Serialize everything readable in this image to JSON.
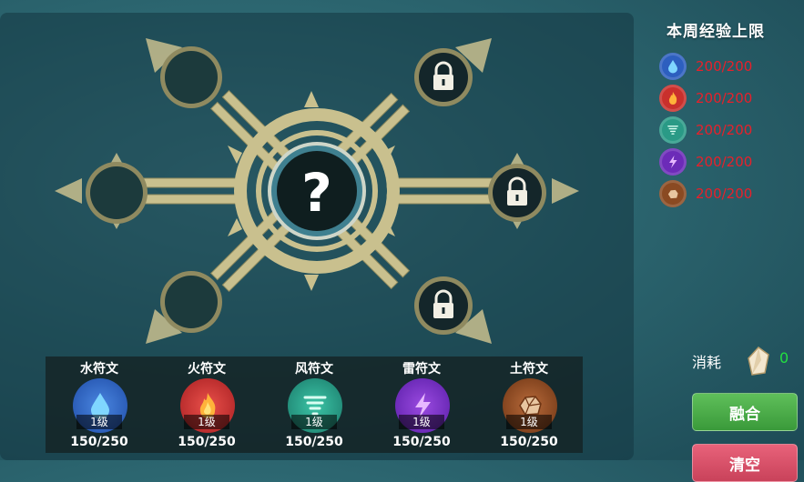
{
  "sidebar": {
    "title": "本周经验上限",
    "exp": [
      {
        "element": "water",
        "icon": "water-drop-icon",
        "value": "200/200",
        "color": "#2d5fbf"
      },
      {
        "element": "fire",
        "icon": "flame-icon",
        "value": "200/200",
        "color": "#c9302c"
      },
      {
        "element": "wind",
        "icon": "tornado-icon",
        "value": "200/200",
        "color": "#2a9a86"
      },
      {
        "element": "thunder",
        "icon": "lightning-icon",
        "value": "200/200",
        "color": "#6c2bb8"
      },
      {
        "element": "earth",
        "icon": "rock-icon",
        "value": "200/200",
        "color": "#8a4a22"
      }
    ],
    "consume_label": "消耗",
    "consume_icon": "crystal-icon",
    "consume_value": "0",
    "fuse_label": "融合",
    "clear_label": "清空"
  },
  "wheel": {
    "center_icon": "question-mark-icon",
    "slots": [
      {
        "position": "upper-left",
        "state": "empty"
      },
      {
        "position": "left",
        "state": "empty"
      },
      {
        "position": "lower-left",
        "state": "empty"
      },
      {
        "position": "upper-right",
        "state": "locked",
        "icon": "lock-icon"
      },
      {
        "position": "right",
        "state": "locked",
        "icon": "lock-icon"
      },
      {
        "position": "lower-right",
        "state": "locked",
        "icon": "lock-icon"
      }
    ]
  },
  "runes": [
    {
      "name": "水符文",
      "level": "1级",
      "progress": "150/250",
      "icon": "water-drop-icon",
      "color": "#2d5fbf"
    },
    {
      "name": "火符文",
      "level": "1级",
      "progress": "150/250",
      "icon": "flame-icon",
      "color": "#c9302c"
    },
    {
      "name": "风符文",
      "level": "1级",
      "progress": "150/250",
      "icon": "tornado-icon",
      "color": "#2a9a86"
    },
    {
      "name": "雷符文",
      "level": "1级",
      "progress": "150/250",
      "icon": "lightning-icon",
      "color": "#6c2bb8"
    },
    {
      "name": "土符文",
      "level": "1级",
      "progress": "150/250",
      "icon": "rock-icon",
      "color": "#8a4a22"
    }
  ]
}
